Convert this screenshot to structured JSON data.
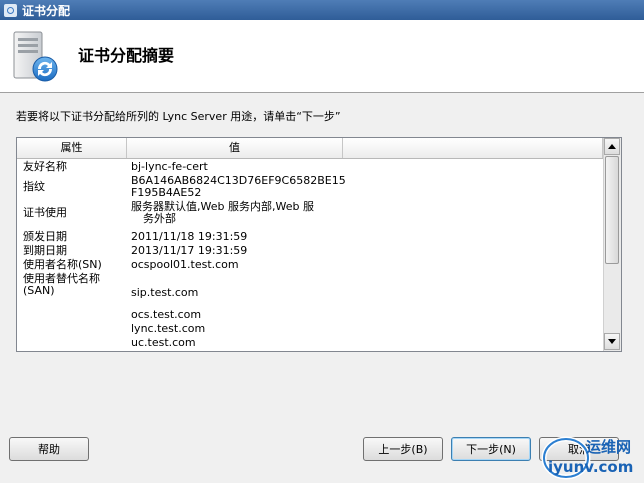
{
  "window": {
    "title": "证书分配"
  },
  "header": {
    "title": "证书分配摘要"
  },
  "instruction": "若要将以下证书分配给所列的 Lync Server 用途，请单击“下一步”",
  "table": {
    "columns": [
      "属性",
      "值"
    ],
    "rows": [
      {
        "property": "友好名称",
        "value": [
          "bj-lync-fe-cert"
        ]
      },
      {
        "property": "指纹",
        "value": [
          "B6A146AB6824C13D76EF9C6582BE15",
          "F195B4AE52"
        ]
      },
      {
        "property": "证书使用",
        "value": [
          "服务器默认值,Web 服务内部,Web 服",
          "务外部"
        ]
      },
      {
        "property": "颁发日期",
        "value": [
          "2011/11/18 19:31:59"
        ]
      },
      {
        "property": "到期日期",
        "value": [
          "2013/11/17 19:31:59"
        ]
      },
      {
        "property": "使用者名称(SN)",
        "value": [
          "ocspool01.test.com"
        ]
      },
      {
        "property": "使用者替代名称(SAN)",
        "value": [
          "sip.test.com"
        ]
      },
      {
        "property": "",
        "value": [
          "ocs.test.com"
        ]
      },
      {
        "property": "",
        "value": [
          "lync.test.com"
        ]
      },
      {
        "property": "",
        "value": [
          "uc.test.com"
        ]
      }
    ]
  },
  "buttons": {
    "help": "帮助",
    "back": "上一步(B)",
    "next": "下一步(N)",
    "cancel": "取消"
  },
  "watermark": {
    "cn": "运维网",
    "url": "iyunv.com"
  },
  "icons": {
    "app": "certificate-wizard-icon",
    "header": "server-sync-icon",
    "scroll_up": "arrow-up-icon",
    "scroll_down": "arrow-down-icon"
  }
}
